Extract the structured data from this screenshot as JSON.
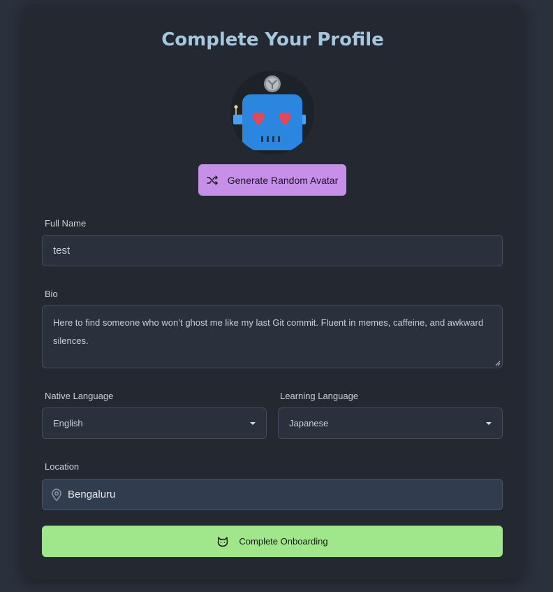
{
  "page": {
    "title": "Complete Your Profile"
  },
  "avatar": {
    "icon": "robot-avatar-icon",
    "random_button_label": "Generate Random Avatar",
    "random_button_icon": "shuffle-icon"
  },
  "form": {
    "full_name": {
      "label": "Full Name",
      "value": "test"
    },
    "bio": {
      "label": "Bio",
      "value": "Here to find someone who won’t ghost me like my last Git commit. Fluent in memes, caffeine, and awkward silences."
    },
    "native_language": {
      "label": "Native Language",
      "value": "English"
    },
    "learning_language": {
      "label": "Learning Language",
      "value": "Japanese"
    },
    "location": {
      "label": "Location",
      "value": "Bengaluru",
      "icon": "map-pin-icon"
    }
  },
  "submit": {
    "label": "Complete Onboarding",
    "icon": "cat-face-icon"
  },
  "colors": {
    "page_bg": "#2a303c",
    "card_bg": "#232831",
    "title": "#a6c8dc",
    "random_button": "#c790e8",
    "submit_button": "#a0e68a",
    "robot_body": "#2b86e0"
  }
}
